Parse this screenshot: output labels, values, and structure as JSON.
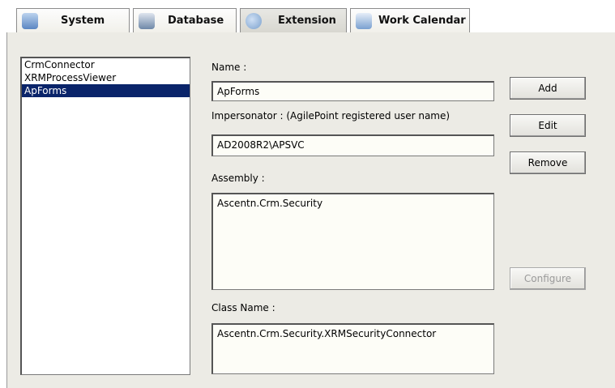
{
  "tabs": [
    {
      "label": "System",
      "icon": "server-icon"
    },
    {
      "label": "Database",
      "icon": "database-icon"
    },
    {
      "label": "Extension",
      "icon": "puzzle-icon"
    },
    {
      "label": "Work Calendar",
      "icon": "calendar-icon"
    }
  ],
  "active_tab": "Extension",
  "extensions": [
    "CrmConnector",
    "XRMProcessViewer",
    "ApForms"
  ],
  "selected_extension": "ApForms",
  "form": {
    "name_label": "Name :",
    "name_value": "ApForms",
    "impersonator_label": "Impersonator : (AgilePoint registered user name)",
    "impersonator_value": "AD2008R2\\APSVC",
    "assembly_label": "Assembly :",
    "assembly_value": "Ascentn.Crm.Security",
    "classname_label": "Class Name :",
    "classname_value": "Ascentn.Crm.Security.XRMSecurityConnector"
  },
  "buttons": {
    "add": "Add",
    "edit": "Edit",
    "remove": "Remove",
    "configure": "Configure"
  },
  "colors": {
    "selection": "#0a246a",
    "panel": "#ecebe5",
    "field": "#fdfdf7"
  }
}
